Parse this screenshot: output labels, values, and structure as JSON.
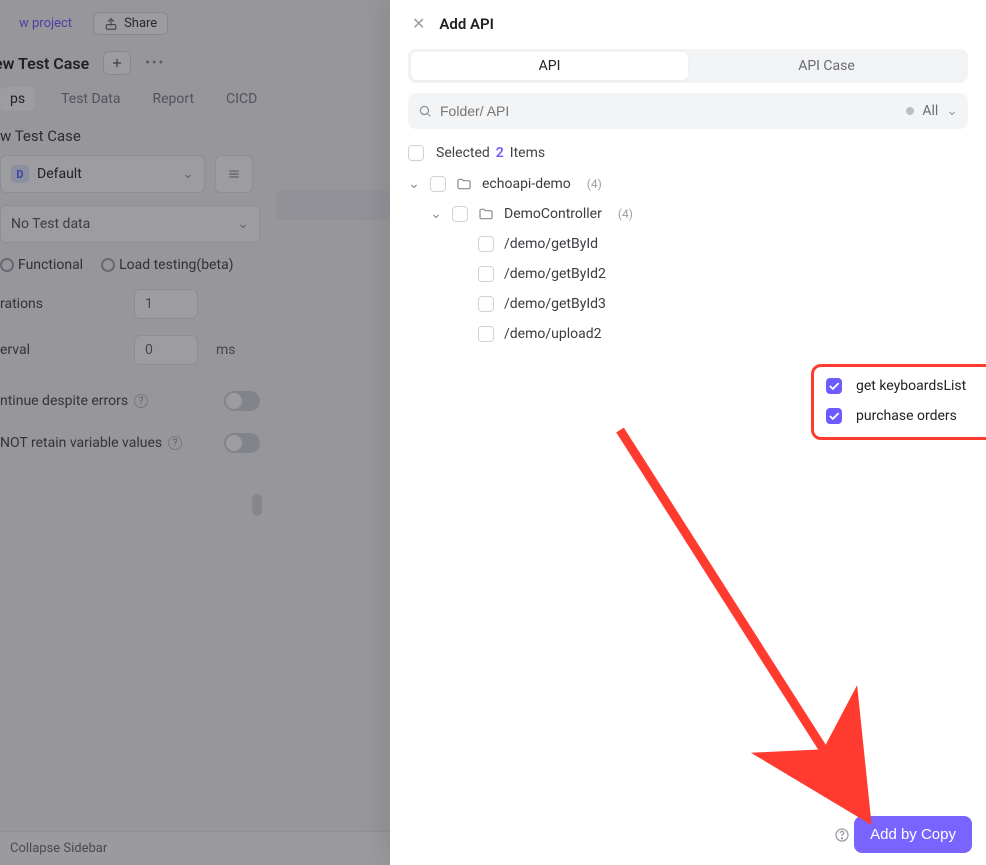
{
  "bg": {
    "project_link": "w project",
    "share_label": "Share",
    "title": "ew Test Case",
    "tabs": {
      "steps": "ps",
      "test_data": "Test Data",
      "report": "Report",
      "cicd": "CICD"
    },
    "crumb": "w Test Case",
    "select": {
      "badge": "D",
      "label": "Default"
    },
    "testdata": "No Test data",
    "mode_functional": "Functional",
    "mode_load": "Load testing(beta)",
    "iterations_k": "rations",
    "iterations_v": "1",
    "interval_k": "erval",
    "interval_v": "0",
    "interval_unit": "ms",
    "continue_l": "ntinue despite errors",
    "retain_l": " NOT retain variable values",
    "collapse": "Collapse Sidebar"
  },
  "panel": {
    "title": "Add API",
    "tab_api": "API",
    "tab_api_case": "API Case",
    "search_placeholder": "Folder/ API",
    "filter_all": "All",
    "selected_prefix": "Selected",
    "selected_count": "2",
    "selected_suffix": "Items",
    "tree": {
      "root": {
        "name": "echoapi-demo",
        "count": "(4)"
      },
      "folder": {
        "name": "DemoController",
        "count": "(4)"
      },
      "leaves": [
        {
          "name": "/demo/getById"
        },
        {
          "name": "/demo/getById2"
        },
        {
          "name": "/demo/getById3"
        },
        {
          "name": "/demo/upload2"
        }
      ],
      "selected": [
        {
          "name": "get keyboardsList"
        },
        {
          "name": "purchase orders"
        }
      ]
    },
    "add_btn": "Add by Copy"
  }
}
